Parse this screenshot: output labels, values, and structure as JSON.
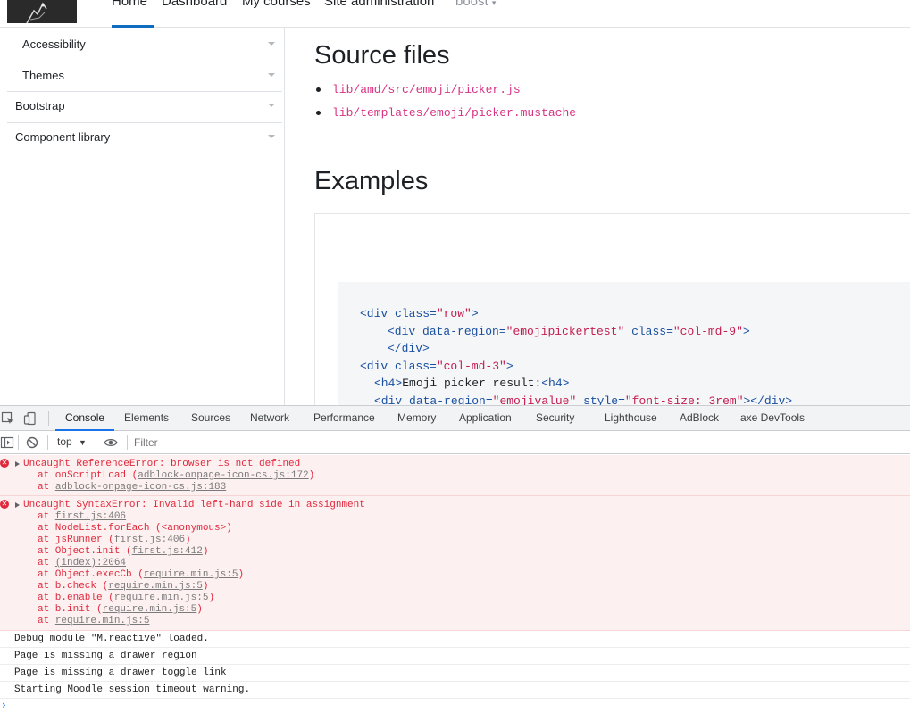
{
  "navbar": {
    "items": [
      "Home",
      "Dashboard",
      "My courses",
      "Site administration"
    ],
    "theme_menu": "boost"
  },
  "sidebar": {
    "items": [
      "Accessibility",
      "Themes",
      "Bootstrap",
      "Component library"
    ]
  },
  "main": {
    "source_heading": "Source files",
    "source_files": [
      "lib/amd/src/emoji/picker.js",
      "lib/templates/emoji/picker.mustache"
    ],
    "examples_heading": "Examples",
    "code": {
      "l1_tag": "<div ",
      "l1_attr": "class=",
      "l1_val": "\"row\"",
      "l1_end": ">",
      "l2_tag": "<div ",
      "l2_attr1": "data-region=",
      "l2_val1": "\"emojipickertest\"",
      "l2_attr2": " class=",
      "l2_val2": "\"col-md-9\"",
      "l2_end": ">",
      "l3": "</div>",
      "l4_tag": "<div ",
      "l4_attr": "class=",
      "l4_val": "\"col-md-3\"",
      "l4_end": ">",
      "l5_tag": "<h4>",
      "l5_text": "Emoji picker result:",
      "l5_end": "<h4>",
      "l6_tag": "<div ",
      "l6_attr1": "data-region=",
      "l6_val1": "\"emojivalue\"",
      "l6_attr2": " style=",
      "l6_val2": "\"font-size: 3rem\"",
      "l6_end": "></div>"
    }
  },
  "devtools": {
    "tabs": [
      "Console",
      "Elements",
      "Sources",
      "Network",
      "Performance",
      "Memory",
      "Application",
      "Security",
      "Lighthouse",
      "AdBlock",
      "axe DevTools"
    ],
    "active_tab": "Console",
    "context": "top",
    "filter_placeholder": "Filter",
    "errors": [
      {
        "head": "Uncaught ReferenceError: browser is not defined",
        "stack": [
          {
            "pre": "at onScriptLoad (",
            "link": "adblock-onpage-icon-cs.js:172",
            "post": ")"
          },
          {
            "pre": "at ",
            "link": "adblock-onpage-icon-cs.js:183",
            "post": ""
          }
        ]
      },
      {
        "head": "Uncaught SyntaxError: Invalid left-hand side in assignment",
        "stack": [
          {
            "pre": "at ",
            "link": "first.js:406",
            "post": ""
          },
          {
            "pre": "at NodeList.forEach (<anonymous>)",
            "link": "",
            "post": ""
          },
          {
            "pre": "at jsRunner (",
            "link": "first.js:406",
            "post": ")"
          },
          {
            "pre": "at Object.init (",
            "link": "first.js:412",
            "post": ")"
          },
          {
            "pre": "at ",
            "link": "(index):2064",
            "post": ""
          },
          {
            "pre": "at Object.execCb (",
            "link": "require.min.js:5",
            "post": ")"
          },
          {
            "pre": "at b.check (",
            "link": "require.min.js:5",
            "post": ")"
          },
          {
            "pre": "at b.enable (",
            "link": "require.min.js:5",
            "post": ")"
          },
          {
            "pre": "at b.init (",
            "link": "require.min.js:5",
            "post": ")"
          },
          {
            "pre": "at ",
            "link": "require.min.js:5",
            "post": ""
          }
        ]
      }
    ],
    "logs": [
      "Debug module \"M.reactive\" loaded.",
      "Page is missing a drawer region",
      "Page is missing a drawer toggle link",
      "Starting Moodle session timeout warning."
    ]
  }
}
